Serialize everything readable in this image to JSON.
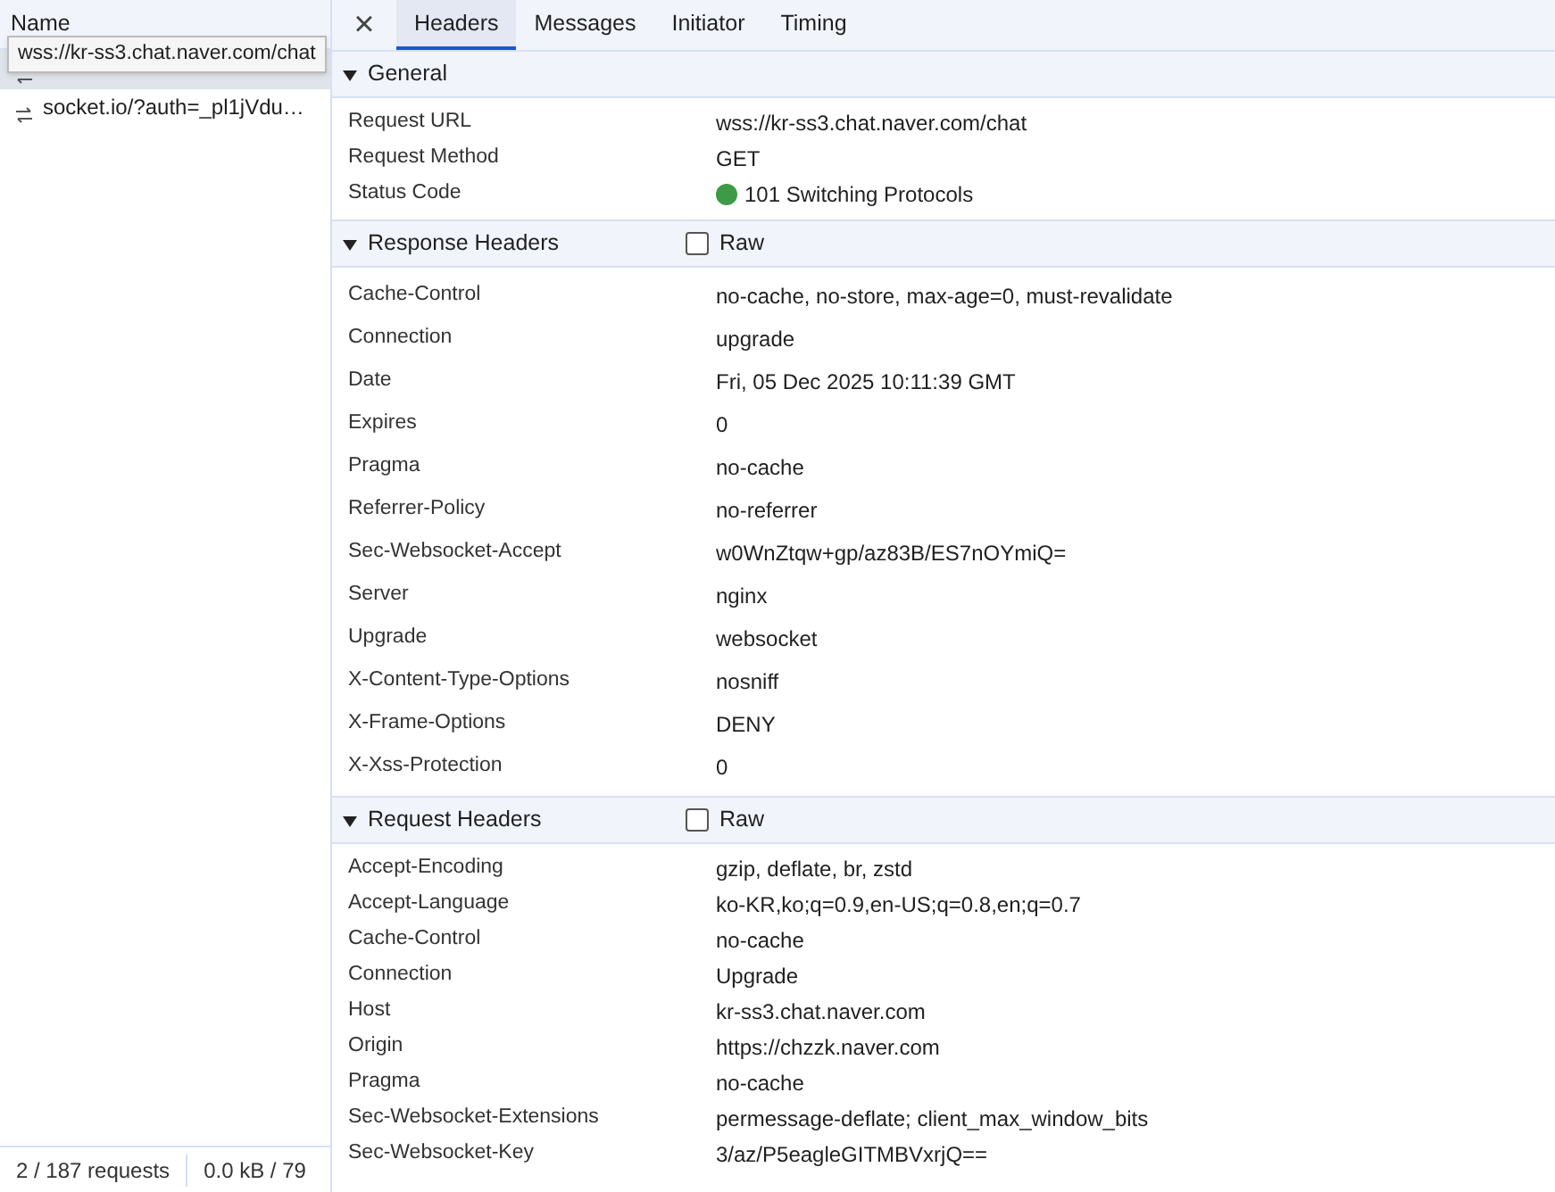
{
  "requests_panel": {
    "column_title": "Name",
    "tooltip": "wss://kr-ss3.chat.naver.com/chat",
    "requests": [
      {
        "selected": true
      },
      {
        "name": "socket.io/?auth=_pl1jVdu…",
        "selected": false
      }
    ],
    "status_bar": [
      "2 / 187 requests",
      "0.0 kB / 79"
    ]
  },
  "close_glyph": "×",
  "tabs": [
    {
      "label": "Headers",
      "selected": true
    },
    {
      "label": "Messages",
      "selected": false
    },
    {
      "label": "Initiator",
      "selected": false
    },
    {
      "label": "Timing",
      "selected": false
    }
  ],
  "sections": [
    {
      "kind": "general",
      "title": "General",
      "expanded": true,
      "rows": [
        {
          "name": "Request URL",
          "value": "wss://kr-ss3.chat.naver.com/chat"
        },
        {
          "name": "Request Method",
          "value": "GET"
        },
        {
          "name": "Status Code",
          "value": "101 Switching Protocols",
          "color": "#3d9a46"
        }
      ]
    },
    {
      "kind": "response",
      "title": "Response Headers",
      "expanded": true,
      "raw": {
        "label": "Raw",
        "checked": false
      },
      "rows": [
        {
          "name": "Cache-Control",
          "value": "no-cache, no-store, max-age=0, must-revalidate"
        },
        {
          "name": "Connection",
          "value": "upgrade"
        },
        {
          "name": "Date",
          "value": "Fri, 05 Dec 2025 10:11:39 GMT"
        },
        {
          "name": "Expires",
          "value": "0"
        },
        {
          "name": "Pragma",
          "value": "no-cache"
        },
        {
          "name": "Referrer-Policy",
          "value": "no-referrer"
        },
        {
          "name": "Sec-Websocket-Accept",
          "value": "w0WnZtqw+gp/az83B/ES7nOYmiQ="
        },
        {
          "name": "Server",
          "value": "nginx"
        },
        {
          "name": "Upgrade",
          "value": "websocket"
        },
        {
          "name": "X-Content-Type-Options",
          "value": "nosniff"
        },
        {
          "name": "X-Frame-Options",
          "value": "DENY"
        },
        {
          "name": "X-Xss-Protection",
          "value": "0"
        }
      ]
    },
    {
      "kind": "request",
      "title": "Request Headers",
      "expanded": true,
      "raw": {
        "label": "Raw",
        "checked": false
      },
      "rows": [
        {
          "name": "Accept-Encoding",
          "value": "gzip, deflate, br, zstd"
        },
        {
          "name": "Accept-Language",
          "value": "ko-KR,ko;q=0.9,en-US;q=0.8,en;q=0.7"
        },
        {
          "name": "Cache-Control",
          "value": "no-cache"
        },
        {
          "name": "Connection",
          "value": "Upgrade"
        },
        {
          "name": "Host",
          "value": "kr-ss3.chat.naver.com"
        },
        {
          "name": "Origin",
          "value": "https://chzzk.naver.com"
        },
        {
          "name": "Pragma",
          "value": "no-cache"
        },
        {
          "name": "Sec-Websocket-Extensions",
          "value": "permessage-deflate; client_max_window_bits"
        },
        {
          "name": "Sec-Websocket-Key",
          "value": "3/az/P5eagleGITMBVxrjQ=="
        }
      ]
    }
  ]
}
